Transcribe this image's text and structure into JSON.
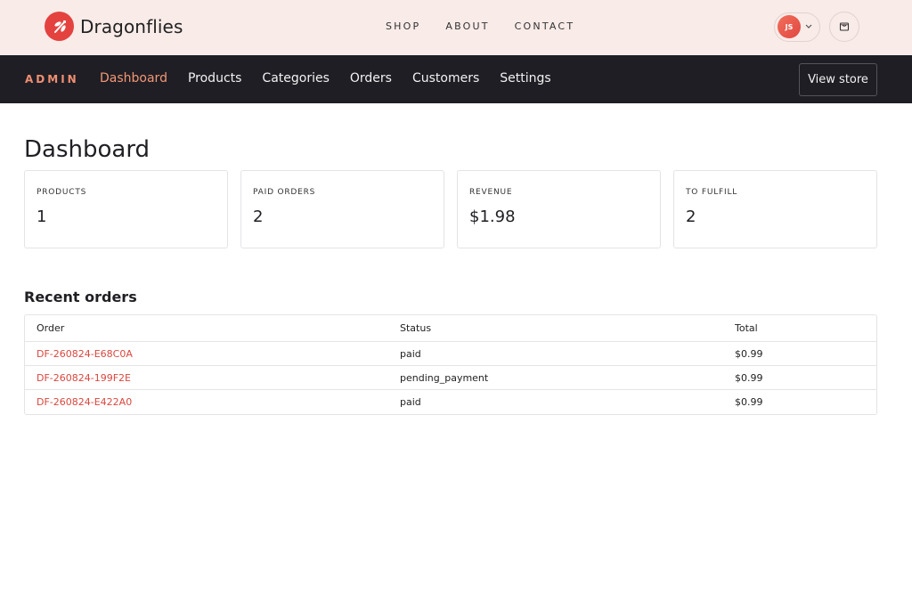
{
  "brand": {
    "name": "Dragonflies",
    "accent": "#e3423f"
  },
  "top_nav": [
    {
      "label": "SHOP"
    },
    {
      "label": "ABOUT"
    },
    {
      "label": "CONTACT"
    }
  ],
  "user": {
    "initials": "JS"
  },
  "admin": {
    "label": "ADMIN",
    "nav": [
      {
        "label": "Dashboard",
        "active": true
      },
      {
        "label": "Products"
      },
      {
        "label": "Categories"
      },
      {
        "label": "Orders"
      },
      {
        "label": "Customers"
      },
      {
        "label": "Settings"
      }
    ],
    "view_store_label": "View store"
  },
  "page": {
    "title": "Dashboard"
  },
  "stats": [
    {
      "label": "PRODUCTS",
      "value": "1"
    },
    {
      "label": "PAID ORDERS",
      "value": "2"
    },
    {
      "label": "REVENUE",
      "value": "$1.98"
    },
    {
      "label": "TO FULFILL",
      "value": "2"
    }
  ],
  "recent_orders": {
    "title": "Recent orders",
    "columns": [
      "Order",
      "Status",
      "Total"
    ],
    "rows": [
      {
        "order": "DF-260824-E68C0A",
        "status": "paid",
        "total": "$0.99"
      },
      {
        "order": "DF-260824-199F2E",
        "status": "pending_payment",
        "total": "$0.99"
      },
      {
        "order": "DF-260824-E422A0",
        "status": "paid",
        "total": "$0.99"
      }
    ]
  }
}
